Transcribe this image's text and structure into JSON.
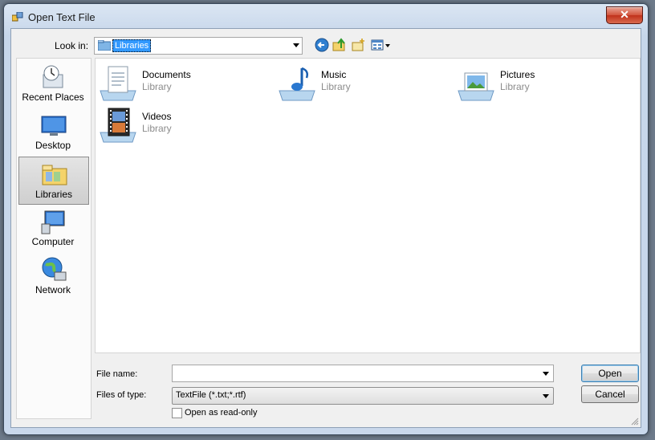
{
  "window": {
    "title": "Open Text File",
    "close_label": "✕"
  },
  "lookin": {
    "label": "Look in:",
    "value": "Libraries"
  },
  "toolbar": {
    "icons": [
      "back-icon",
      "up-folder-icon",
      "new-folder-icon",
      "view-menu-icon"
    ]
  },
  "places": [
    {
      "label": "Recent Places",
      "icon": "recent-places-icon"
    },
    {
      "label": "Desktop",
      "icon": "desktop-icon"
    },
    {
      "label": "Libraries",
      "icon": "libraries-icon",
      "selected": true
    },
    {
      "label": "Computer",
      "icon": "computer-icon"
    },
    {
      "label": "Network",
      "icon": "network-icon"
    }
  ],
  "libraries": [
    {
      "name": "Documents",
      "kind": "Library",
      "icon": "documents-library-icon"
    },
    {
      "name": "Music",
      "kind": "Library",
      "icon": "music-library-icon"
    },
    {
      "name": "Pictures",
      "kind": "Library",
      "icon": "pictures-library-icon"
    },
    {
      "name": "Videos",
      "kind": "Library",
      "icon": "videos-library-icon"
    }
  ],
  "form": {
    "filename_label": "File name:",
    "filename_value": "",
    "filetype_label": "Files of type:",
    "filetype_value": "TextFile (*.txt;*.rtf)",
    "readonly_label": "Open as read-only",
    "readonly_checked": false
  },
  "buttons": {
    "open": "Open",
    "cancel": "Cancel"
  },
  "colors": {
    "selection": "#3399ff",
    "title_bar": "#c6d6ea",
    "close_button": "#c0311b"
  }
}
